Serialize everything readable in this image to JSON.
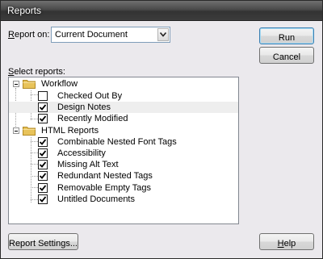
{
  "window": {
    "title": "Reports"
  },
  "report_on": {
    "label_prefix": "R",
    "label_rest": "eport on:",
    "selected": "Current Document"
  },
  "select_reports": {
    "label_prefix": "S",
    "label_rest": "elect reports:"
  },
  "tree": {
    "groups": [
      {
        "label": "Workflow",
        "items": [
          {
            "label": "Checked Out By",
            "checked": false
          },
          {
            "label": "Design Notes",
            "checked": true
          },
          {
            "label": "Recently Modified",
            "checked": true
          }
        ]
      },
      {
        "label": "HTML Reports",
        "items": [
          {
            "label": "Combinable Nested Font Tags",
            "checked": true
          },
          {
            "label": "Accessibility",
            "checked": true
          },
          {
            "label": "Missing Alt Text",
            "checked": true
          },
          {
            "label": "Redundant Nested Tags",
            "checked": true
          },
          {
            "label": "Removable Empty Tags",
            "checked": true
          },
          {
            "label": "Untitled Documents",
            "checked": true
          }
        ]
      }
    ]
  },
  "buttons": {
    "run": "Run",
    "cancel": "Cancel",
    "report_settings": "Report Settings...",
    "help_prefix": "H",
    "help_rest": "elp"
  },
  "colors": {
    "folder": "#e8c35a",
    "check": "#000000",
    "titlebar": "#3c3c3c"
  }
}
